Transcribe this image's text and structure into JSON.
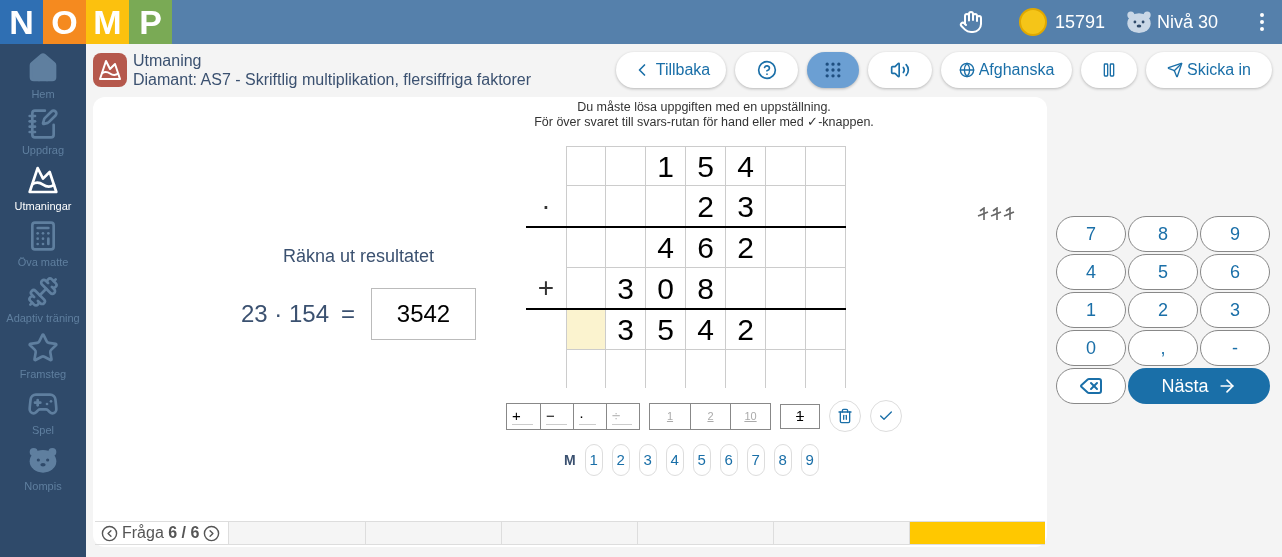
{
  "topbar": {
    "logo": [
      {
        "letter": "N",
        "color": "#2f6fb3"
      },
      {
        "letter": "O",
        "color": "#f58a1f"
      },
      {
        "letter": "M",
        "color": "#fcc10e"
      },
      {
        "letter": "P",
        "color": "#7aaa55"
      }
    ],
    "coins": "15791",
    "level": "Nivå 30"
  },
  "sidebar": {
    "items": [
      {
        "label": "Hem",
        "selected": false
      },
      {
        "label": "Uppdrag",
        "selected": false
      },
      {
        "label": "Utmaningar",
        "selected": true
      },
      {
        "label": "Öva matte",
        "selected": false
      },
      {
        "label": "Adaptiv träning",
        "selected": false
      },
      {
        "label": "Framsteg",
        "selected": false
      },
      {
        "label": "Spel",
        "selected": false
      },
      {
        "label": "Nompis",
        "selected": false
      }
    ]
  },
  "header": {
    "category": "Utmaning",
    "title": "Diamant: AS7 - Skriftlig multiplikation, flersiffriga faktorer",
    "buttons": [
      {
        "kind": "text",
        "label": "Tillbaka",
        "selected": false
      },
      {
        "kind": "icon",
        "selected": false
      },
      {
        "kind": "icon",
        "selected": true
      },
      {
        "kind": "icon",
        "selected": false
      },
      {
        "kind": "text",
        "label": "Afghanska",
        "selected": false
      },
      {
        "kind": "icon",
        "selected": false
      },
      {
        "kind": "text",
        "label": "Skicka in",
        "selected": false
      }
    ]
  },
  "task": {
    "prompt": "Räkna ut resultatet",
    "expression": "23 · 154",
    "equals": "=",
    "answer": "3542"
  },
  "instructions": [
    "Du måste lösa uppgiften med en uppställning.",
    "För över svaret till svars-rutan för hand eller med ✓-knappen."
  ],
  "grid": {
    "rows": [
      {
        "kind": "row",
        "operator": "",
        "cells": [
          {
            "text": "",
            "highlighted": false
          },
          {
            "text": "",
            "highlighted": false
          },
          {
            "text": "1",
            "highlighted": false
          },
          {
            "text": "5",
            "highlighted": false
          },
          {
            "text": "4",
            "highlighted": false
          },
          {
            "text": "",
            "highlighted": false
          },
          {
            "text": "",
            "highlighted": false
          }
        ]
      },
      {
        "kind": "row",
        "operator": "·",
        "cells": [
          {
            "text": "",
            "highlighted": false
          },
          {
            "text": "",
            "highlighted": false
          },
          {
            "text": "",
            "highlighted": false
          },
          {
            "text": "2",
            "highlighted": false
          },
          {
            "text": "3",
            "highlighted": false
          },
          {
            "text": "",
            "highlighted": false
          },
          {
            "text": "",
            "highlighted": false
          }
        ]
      },
      {
        "kind": "rule"
      },
      {
        "kind": "row",
        "operator": "",
        "cells": [
          {
            "text": "",
            "highlighted": false
          },
          {
            "text": "",
            "highlighted": false
          },
          {
            "text": "4",
            "highlighted": false
          },
          {
            "text": "6",
            "highlighted": false
          },
          {
            "text": "2",
            "highlighted": false
          },
          {
            "text": "",
            "highlighted": false
          },
          {
            "text": "",
            "highlighted": false
          }
        ]
      },
      {
        "kind": "row",
        "operator": "+",
        "cells": [
          {
            "text": "",
            "highlighted": false
          },
          {
            "text": "3",
            "highlighted": false
          },
          {
            "text": "0",
            "highlighted": false
          },
          {
            "text": "8",
            "highlighted": false
          },
          {
            "text": "",
            "highlighted": false
          },
          {
            "text": "",
            "highlighted": false
          },
          {
            "text": "",
            "highlighted": false
          }
        ]
      },
      {
        "kind": "rule"
      },
      {
        "kind": "row",
        "operator": "",
        "cells": [
          {
            "text": "",
            "highlighted": true
          },
          {
            "text": "3",
            "highlighted": false
          },
          {
            "text": "5",
            "highlighted": false
          },
          {
            "text": "4",
            "highlighted": false
          },
          {
            "text": "2",
            "highlighted": false
          },
          {
            "text": "",
            "highlighted": false
          },
          {
            "text": "",
            "highlighted": false
          }
        ]
      },
      {
        "kind": "row",
        "operator": "",
        "cells": [
          {
            "text": "",
            "highlighted": false
          },
          {
            "text": "",
            "highlighted": false
          },
          {
            "text": "",
            "highlighted": false
          },
          {
            "text": "",
            "highlighted": false
          },
          {
            "text": "",
            "highlighted": false
          },
          {
            "text": "",
            "highlighted": false
          },
          {
            "text": "",
            "highlighted": false
          }
        ]
      }
    ]
  },
  "tools": {
    "operators": [
      {
        "label": "+",
        "disabled": false
      },
      {
        "label": "−",
        "disabled": false
      },
      {
        "label": "·",
        "disabled": false
      },
      {
        "label": "÷",
        "disabled": true
      }
    ],
    "columns": [
      {
        "label": "1",
        "disabled": true
      },
      {
        "label": "2",
        "disabled": true
      },
      {
        "label": "10",
        "disabled": true
      }
    ],
    "carry": "1"
  },
  "memory": {
    "label": "M",
    "keys": [
      "1",
      "2",
      "3",
      "4",
      "5",
      "6",
      "7",
      "8",
      "9"
    ]
  },
  "keypad": {
    "keys": [
      "7",
      "8",
      "9",
      "4",
      "5",
      "6",
      "1",
      "2",
      "3",
      "0",
      ",",
      "-"
    ],
    "next": "Nästa"
  },
  "footer": {
    "label": "Fråga",
    "current": "6 / 6",
    "segments": [
      {
        "filled": false
      },
      {
        "filled": false
      },
      {
        "filled": false
      },
      {
        "filled": false
      },
      {
        "filled": false
      },
      {
        "filled": true
      }
    ]
  }
}
